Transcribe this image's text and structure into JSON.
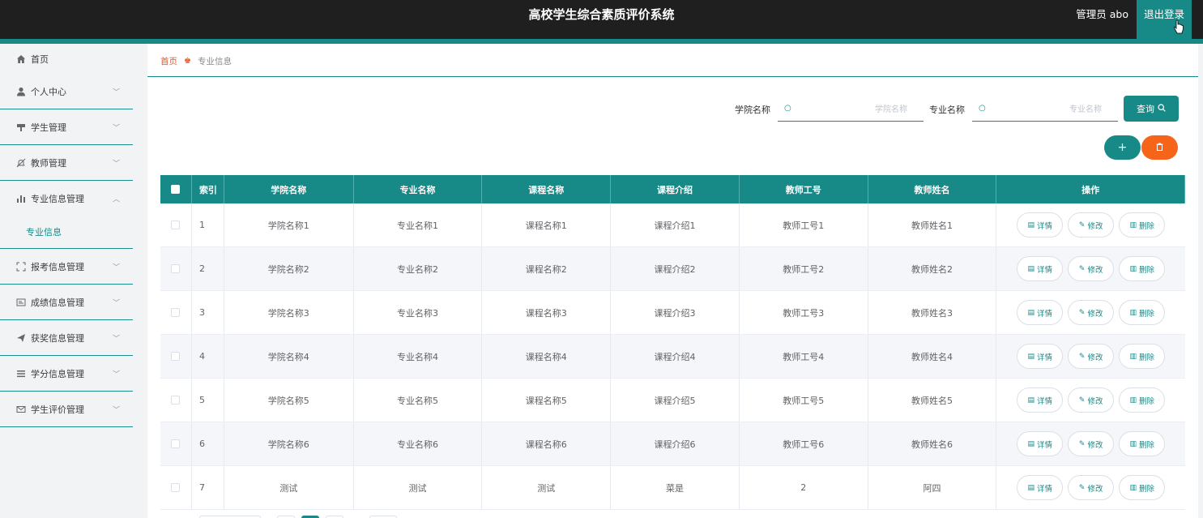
{
  "header": {
    "title": "高校学生综合素质评价系统",
    "user_label": "管理员 abo",
    "logout_label": "退出登录"
  },
  "sidebar": {
    "items": [
      {
        "label": "首页",
        "icon": "home-icon"
      },
      {
        "label": "个人中心",
        "icon": "user-icon"
      },
      {
        "label": "学生管理",
        "icon": "student-icon"
      },
      {
        "label": "教师管理",
        "icon": "bell-icon"
      },
      {
        "label": "专业信息管理",
        "icon": "bar-chart-icon",
        "expanded": true
      },
      {
        "label": "报考信息管理",
        "icon": "fullscreen-icon"
      },
      {
        "label": "成绩信息管理",
        "icon": "card-icon"
      },
      {
        "label": "获奖信息管理",
        "icon": "send-icon"
      },
      {
        "label": "学分信息管理",
        "icon": "menu-icon"
      },
      {
        "label": "学生评价管理",
        "icon": "mail-icon"
      }
    ],
    "subitem": "专业信息"
  },
  "breadcrumb": {
    "home": "首页",
    "current": "专业信息"
  },
  "search": {
    "college_label": "学院名称",
    "college_placeholder": "学院名称",
    "major_label": "专业名称",
    "major_placeholder": "专业名称",
    "query_label": "查询"
  },
  "table": {
    "headers": [
      "索引",
      "学院名称",
      "专业名称",
      "课程名称",
      "课程介绍",
      "教师工号",
      "教师姓名",
      "操作"
    ],
    "rows": [
      [
        "1",
        "学院名称1",
        "专业名称1",
        "课程名称1",
        "课程介绍1",
        "教师工号1",
        "教师姓名1"
      ],
      [
        "2",
        "学院名称2",
        "专业名称2",
        "课程名称2",
        "课程介绍2",
        "教师工号2",
        "教师姓名2"
      ],
      [
        "3",
        "学院名称3",
        "专业名称3",
        "课程名称3",
        "课程介绍3",
        "教师工号3",
        "教师姓名3"
      ],
      [
        "4",
        "学院名称4",
        "专业名称4",
        "课程名称4",
        "课程介绍4",
        "教师工号4",
        "教师姓名4"
      ],
      [
        "5",
        "学院名称5",
        "专业名称5",
        "课程名称5",
        "课程介绍5",
        "教师工号5",
        "教师姓名5"
      ],
      [
        "6",
        "学院名称6",
        "专业名称6",
        "课程名称6",
        "课程介绍6",
        "教师工号6",
        "教师姓名6"
      ],
      [
        "7",
        "测试",
        "测试",
        "测试",
        "菜是",
        "2",
        "阿四"
      ]
    ],
    "actions": {
      "detail": "详情",
      "edit": "修改",
      "delete": "删除"
    }
  },
  "colors": {
    "accent": "#178a87",
    "danger": "#f56418",
    "topbar": "#1f1f1f"
  }
}
